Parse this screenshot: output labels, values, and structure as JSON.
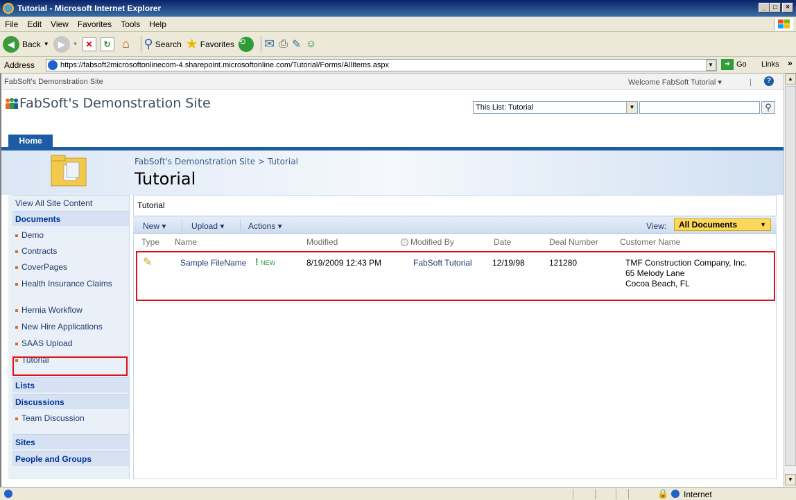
{
  "window": {
    "title": "Tutorial - Microsoft Internet Explorer",
    "min": "_",
    "max": "□",
    "close": "×"
  },
  "menu": [
    "File",
    "Edit",
    "View",
    "Favorites",
    "Tools",
    "Help"
  ],
  "toolbar": {
    "back": "Back",
    "search": "Search",
    "favorites": "Favorites"
  },
  "address": {
    "label": "Address",
    "url": "https://fabsoft2microsoftonlinecom-4.sharepoint.microsoftonline.com/Tutorial/Forms/AllItems.aspx",
    "go": "Go",
    "links": "Links"
  },
  "sp": {
    "top_site": "FabSoft's Demonstration Site",
    "welcome": "Welcome FabSoft Tutorial ▾",
    "help": "?",
    "site_name": "FabSoft's Demonstration Site",
    "search_scope": "This List: Tutorial",
    "home_tab": "Home",
    "breadcrumb": "FabSoft's Demonstration Site > Tutorial",
    "page_title": "Tutorial",
    "list_caption": "Tutorial"
  },
  "nav": {
    "view_all": "View All Site Content",
    "documents": "Documents",
    "doc_items": [
      "Demo",
      "Contracts",
      "CoverPages",
      "Health Insurance Claims",
      "Hernia Workflow",
      "New Hire Applications",
      "SAAS Upload",
      "Tutorial"
    ],
    "lists": "Lists",
    "discussions": "Discussions",
    "disc_items": [
      "Team Discussion"
    ],
    "sites": "Sites",
    "people": "People and Groups"
  },
  "listbar": {
    "new": "New ▾",
    "upload": "Upload ▾",
    "actions": "Actions ▾",
    "view_label": "View:",
    "view_value": "All Documents"
  },
  "columns": [
    "Type",
    "Name",
    "Modified",
    "Modified By",
    "Date",
    "Deal Number",
    "Customer Name"
  ],
  "row": {
    "name": "Sample FileName",
    "new_badge": "NEW",
    "modified": "8/19/2009 12:43 PM",
    "modified_by": "FabSoft Tutorial",
    "date": "12/19/98",
    "deal": "121280",
    "cust1": "TMF Construction Company, Inc.",
    "cust2": "65 Melody Lane",
    "cust3": "Cocoa Beach, FL"
  },
  "status": {
    "zone": "Internet"
  },
  "colors": {
    "accent": "#1d5ba4",
    "highlight": "#e0101a",
    "view_bg": "#fbd75b"
  }
}
